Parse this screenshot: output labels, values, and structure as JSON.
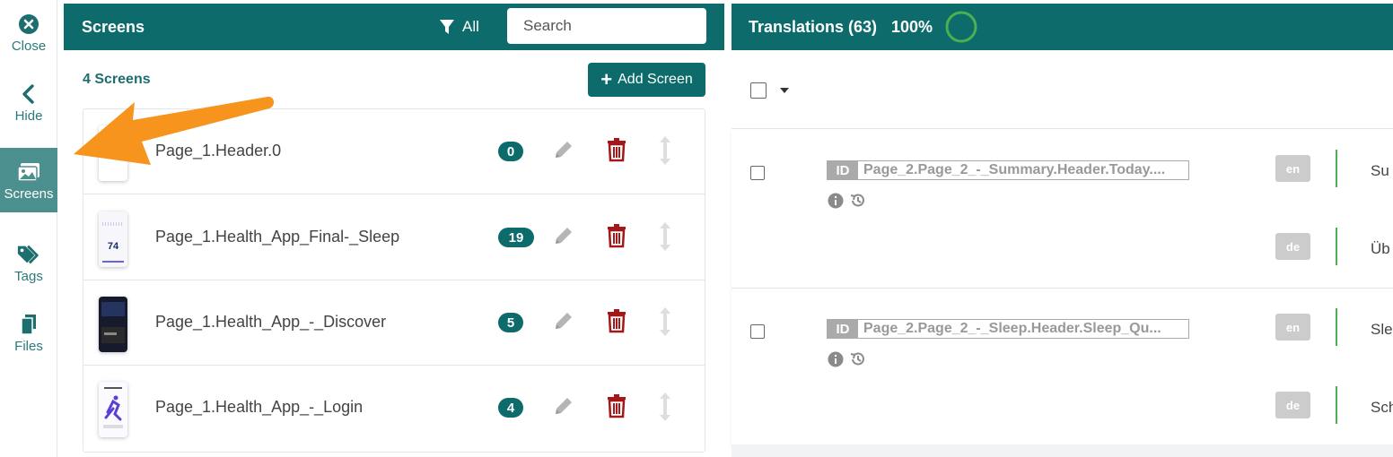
{
  "sidebar": {
    "items": [
      {
        "label": "Close",
        "icon": "close-circle-icon"
      },
      {
        "label": "Hide",
        "icon": "chevron-left-icon"
      },
      {
        "label": "Screens",
        "icon": "images-icon",
        "active": true
      },
      {
        "label": "Tags",
        "icon": "tags-icon"
      },
      {
        "label": "Files",
        "icon": "files-icon"
      }
    ]
  },
  "screens_panel": {
    "title": "Screens",
    "filter_label": "All",
    "search_placeholder": "Search",
    "count_label": "4 Screens",
    "add_button_label": "Add Screen",
    "rows": [
      {
        "name": "Page_1.Header.0",
        "count": "0"
      },
      {
        "name": "Page_1.Health_App_Final-_Sleep",
        "count": "19",
        "thumb_text": "74"
      },
      {
        "name": "Page_1.Health_App_-_Discover",
        "count": "5"
      },
      {
        "name": "Page_1.Health_App_-_Login",
        "count": "4"
      }
    ]
  },
  "translations_panel": {
    "title": "Translations (63)",
    "progress_text": "100%",
    "progress_value": 1.0,
    "entries": [
      {
        "id_label": "ID",
        "id_value": "Page_2.Page_2_-_Summary.Header.Today....",
        "translations": [
          {
            "lang": "en",
            "text": "Su"
          },
          {
            "lang": "de",
            "text": "Üb"
          }
        ]
      },
      {
        "id_label": "ID",
        "id_value": "Page_2.Page_2_-_Sleep.Header.Sleep_Qu...",
        "translations": [
          {
            "lang": "en",
            "text": "Sle"
          },
          {
            "lang": "de",
            "text": "Sch"
          }
        ]
      }
    ]
  },
  "colors": {
    "header_teal": "#0d6b6b",
    "rail_active": "#4c8f8f",
    "delete_red": "#a31919",
    "progress_green": "#4caf50",
    "annotation_orange": "#f7941d"
  }
}
